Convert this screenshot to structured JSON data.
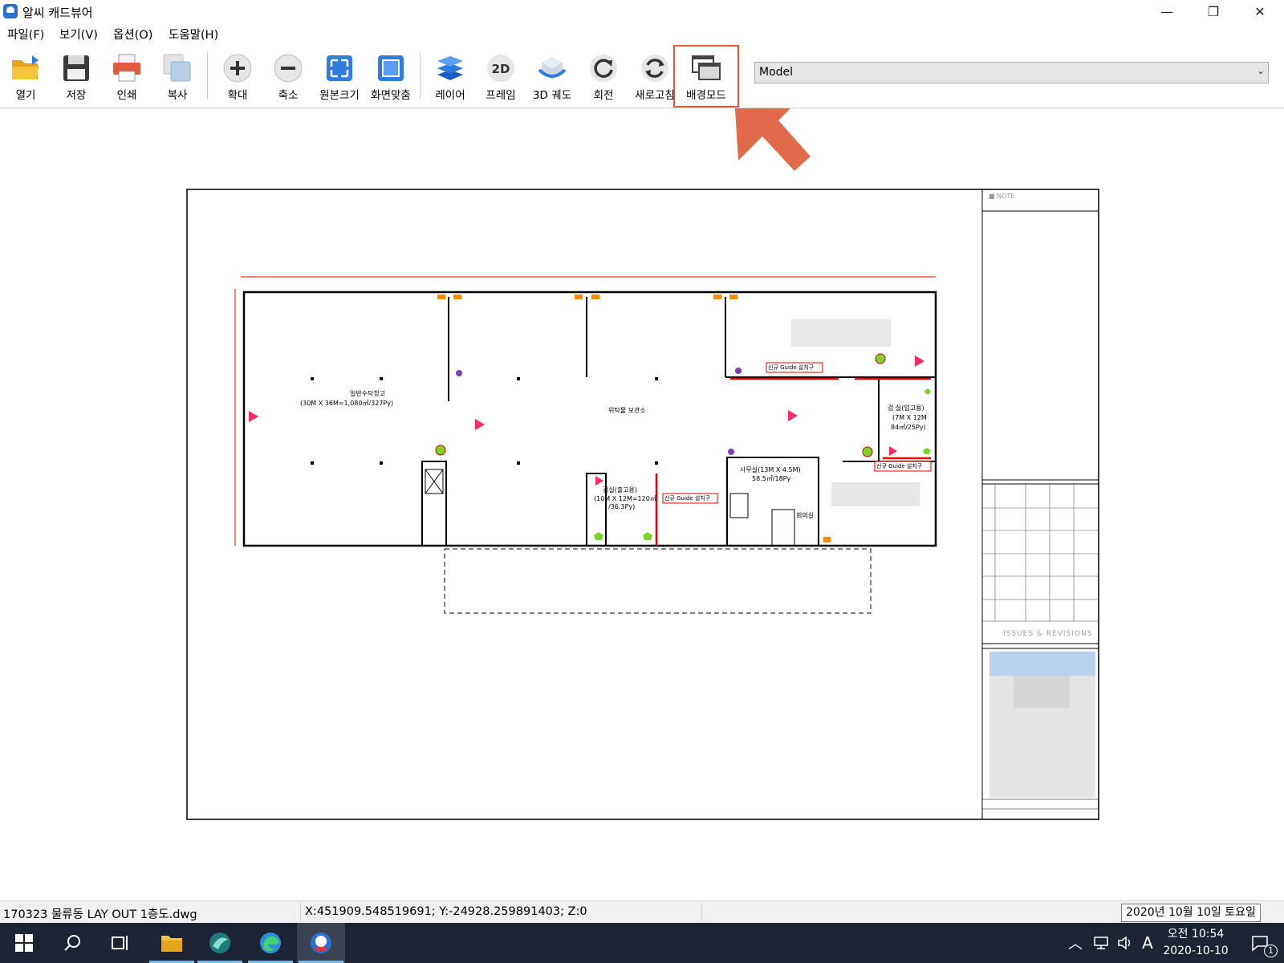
{
  "window": {
    "title": "알씨 캐드뷰어",
    "controls": {
      "minimize": "—",
      "maximize": "❐",
      "close": "✕"
    }
  },
  "menu": [
    {
      "label": "파일(F)"
    },
    {
      "label": "보기(V)"
    },
    {
      "label": "옵션(O)"
    },
    {
      "label": "도움말(H)"
    }
  ],
  "toolbar": {
    "buttons": [
      {
        "label": "열기",
        "icon": "folder-open-icon"
      },
      {
        "label": "저장",
        "icon": "save-icon"
      },
      {
        "label": "인쇄",
        "icon": "print-icon"
      },
      {
        "label": "복사",
        "icon": "copy-icon"
      },
      {
        "label": "확대",
        "icon": "zoom-in-icon"
      },
      {
        "label": "축소",
        "icon": "zoom-out-icon"
      },
      {
        "label": "원본크기",
        "icon": "actual-size-icon"
      },
      {
        "label": "화면맞춤",
        "icon": "fit-screen-icon"
      },
      {
        "label": "레이어",
        "icon": "layers-icon"
      },
      {
        "label": "프레임",
        "icon": "2d-frame-icon",
        "icon_text": "2D"
      },
      {
        "label": "3D 궤도",
        "icon": "3d-orbit-icon"
      },
      {
        "label": "회전",
        "icon": "rotate-icon"
      },
      {
        "label": "새로고침",
        "icon": "refresh-icon"
      },
      {
        "label": "배경모드",
        "icon": "background-mode-icon"
      }
    ],
    "highlighted": "배경모드",
    "highlight_color": "#e05a3c",
    "layout_select": {
      "value": "Model"
    }
  },
  "drawing": {
    "title_block": {
      "note": "■ NOTE",
      "revisions_label": "ISSUES & REVISIONS"
    },
    "rooms": {
      "left_warehouse": "일반수탁창고",
      "left_warehouse_size": "(30M X 36M=1,080㎡/327Py)",
      "center": "위탁물 보관소",
      "right_room": "검 실(임고용)",
      "right_room_size": "(7M X 12M",
      "right_room_area": "84㎡/25Py)",
      "office": "사무실(13M X 4.5M)",
      "office_area": "58.5㎡/18Py",
      "bottom_room": "검실(출고용)",
      "bottom_room_size": "(10M X 12M=120㎡",
      "bottom_room_area": "/36.3Py)",
      "small_room": "회의실"
    },
    "guide_labels": [
      "신규 Guide 설치구",
      "신규 Guide 설치구",
      "신규 Guide 설치구"
    ]
  },
  "status": {
    "file": "170323 물류동 LAY OUT 1층도.dwg",
    "coords": "X:451909.548519691; Y:-24928.259891403; Z:0",
    "date_tooltip": "2020년 10월 10일 토요일"
  },
  "taskbar": {
    "clock_period_time": "오전 10:54",
    "clock_date": "2020-10-10",
    "ime": "A",
    "notification_count": "1"
  }
}
